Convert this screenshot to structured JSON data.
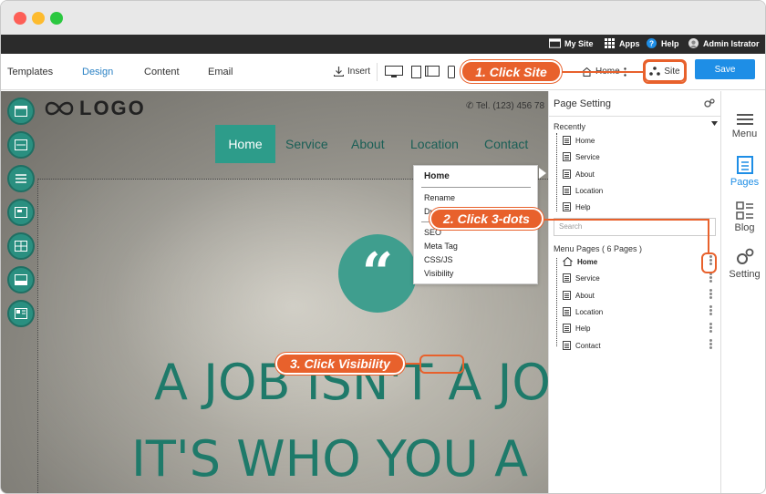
{
  "topbar": {
    "my_site": "My Site",
    "apps": "Apps",
    "help": "Help",
    "user": "Admin Istrator"
  },
  "toolbar": {
    "tabs": [
      "Templates",
      "Design",
      "Content",
      "Email"
    ],
    "active_tab": "Design",
    "insert": "Insert",
    "home_page": "Home",
    "site": "Site",
    "save": "Save"
  },
  "canvas": {
    "logo": "LOGO",
    "tel": "Tel. (123) 456 78",
    "nav": [
      "Home",
      "Service",
      "About",
      "Location",
      "Contact"
    ],
    "quote_mark": "“",
    "hero_line1": "A JOB ISN'T A JO",
    "hero_line2": "IT'S WHO YOU A"
  },
  "context_menu": {
    "header": "Home",
    "items": [
      "Rename",
      "Duplicate",
      "SEO",
      "Meta Tag",
      "CSS/JS",
      "Visibility"
    ]
  },
  "page_panel": {
    "title": "Page Setting",
    "recently_label": "Recently",
    "recently": [
      "Home",
      "Service",
      "About",
      "Location",
      "Help"
    ],
    "search_placeholder": "Search",
    "menu_pages_label": "Menu Pages ( 6 Pages )",
    "menu_pages": [
      "Home",
      "Service",
      "About",
      "Location",
      "Help",
      "Contact"
    ]
  },
  "right_rail": {
    "items": [
      "Menu",
      "Pages",
      "Blog",
      "Setting"
    ],
    "active": "Pages"
  },
  "callouts": {
    "step1": "1. Click Site",
    "step2": "2. Click 3-dots",
    "step3": "3. Click Visibility"
  },
  "colors": {
    "accent": "#e8612c",
    "teal": "#2d9c8a",
    "save_blue": "#1e8ee6"
  }
}
